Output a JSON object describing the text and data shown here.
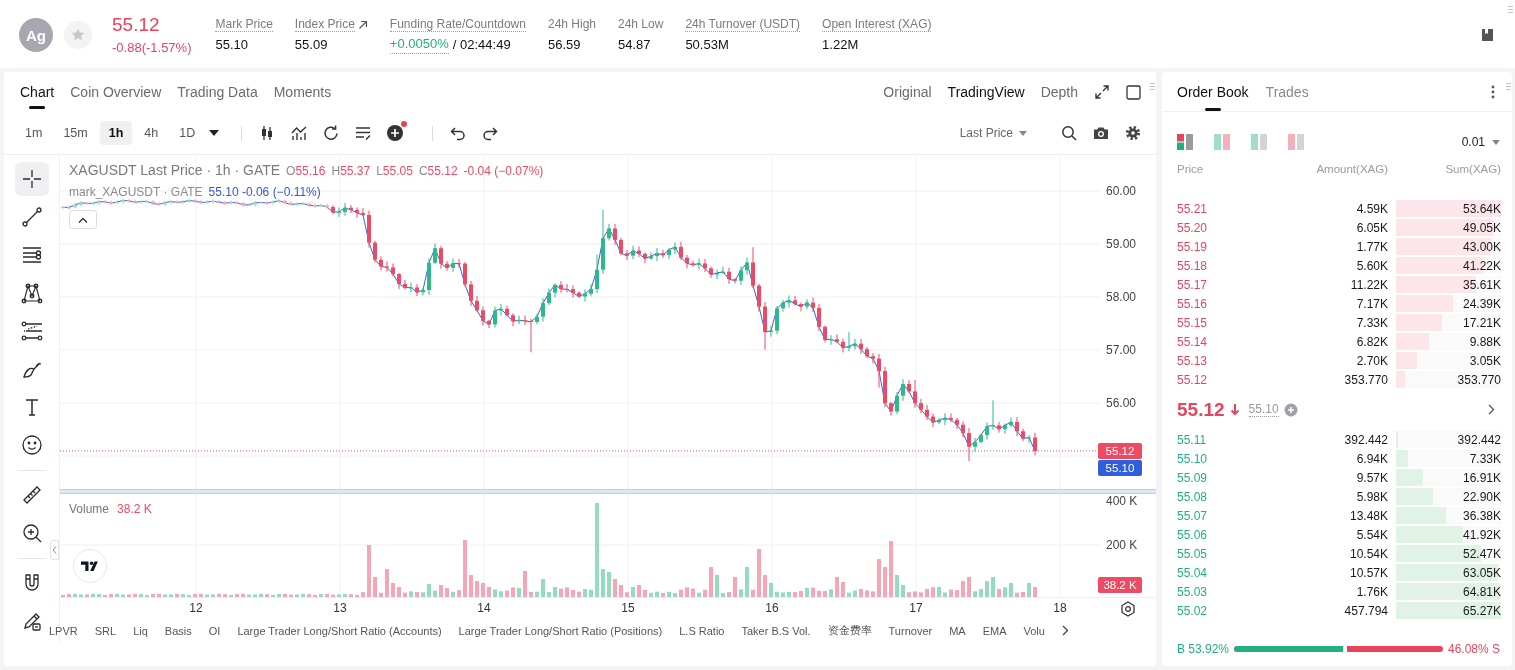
{
  "header": {
    "avatar": "Ag",
    "favorite": false,
    "last_price": "55.12",
    "change": "-0.88(-1.57%)",
    "stats": [
      {
        "label": "Mark Price",
        "underlined": true,
        "link": false,
        "value": "55.10"
      },
      {
        "label": "Index Price",
        "underlined": true,
        "link": true,
        "value": "55.09"
      },
      {
        "label": "Funding Rate/Countdown",
        "underlined": true,
        "link": false,
        "rate": "+0.0050%",
        "value": "/ 02:44:49"
      },
      {
        "label": "24h High",
        "underlined": false,
        "link": false,
        "value": "56.59"
      },
      {
        "label": "24h Low",
        "underlined": false,
        "link": false,
        "value": "54.87"
      },
      {
        "label": "24h Turnover (USDT)",
        "underlined": true,
        "link": false,
        "value": "50.53M"
      },
      {
        "label": "Open Interest (XAG)",
        "underlined": true,
        "link": false,
        "value": "1.22M"
      }
    ]
  },
  "chart_panel": {
    "tabs": [
      {
        "label": "Chart",
        "selected": true
      },
      {
        "label": "Coin Overview",
        "selected": false
      },
      {
        "label": "Trading Data",
        "selected": false
      },
      {
        "label": "Moments",
        "selected": false
      }
    ],
    "views": [
      {
        "label": "Original",
        "selected": false
      },
      {
        "label": "TradingView",
        "selected": true
      },
      {
        "label": "Depth",
        "selected": false
      }
    ],
    "intervals": [
      {
        "label": "1m",
        "selected": false
      },
      {
        "label": "15m",
        "selected": false
      },
      {
        "label": "1h",
        "selected": true
      },
      {
        "label": "4h",
        "selected": false
      },
      {
        "label": "1D",
        "selected": false
      }
    ],
    "add_indicator_dot": true,
    "price_source": "Last Price",
    "drawing_tools": [
      {
        "selected": true
      },
      {
        "selected": false
      },
      {
        "selected": false
      },
      {
        "selected": false
      },
      {
        "selected": false
      },
      {
        "selected": false
      },
      {
        "selected": false
      },
      {
        "selected": false
      },
      {
        "selected": false
      },
      {
        "selected": false
      },
      {
        "selected": false
      },
      {
        "selected": false
      }
    ],
    "legend": {
      "title": "XAGUSDT Last Price · 1h · GATE",
      "ohlc": [
        {
          "key": "O",
          "value": "55.16"
        },
        {
          "key": "H",
          "value": "55.37"
        },
        {
          "key": "L",
          "value": "55.05"
        },
        {
          "key": "C",
          "value": "55.12"
        }
      ],
      "change": "-0.04 (−0.07%)",
      "mark_title": "mark_XAGUSDT · GATE",
      "mark_values": "55.10 -0.06 (−0.11%)"
    },
    "price_axis": [
      "60.00",
      "59.00",
      "58.00",
      "57.00",
      "56.00"
    ],
    "price_tags": [
      {
        "kind": "last",
        "text": "55.12"
      },
      {
        "kind": "mark",
        "text": "55.10"
      }
    ],
    "volume_legend": {
      "label": "Volume",
      "value": "38.2 K"
    },
    "volume_axis": [
      "400 K",
      "200 K"
    ],
    "volume_tag": "38.2 K",
    "time_axis": [
      "12",
      "13",
      "14",
      "15",
      "16",
      "17",
      "18"
    ],
    "indicators": [
      "LPVR",
      "SRL",
      "Liq",
      "Basis",
      "OI",
      "Large Trader Long/Short Ratio (Accounts)",
      "Large Trader Long/Short Ratio (Positions)",
      "L.S Ratio",
      "Taker B.S Vol.",
      "资金费率",
      "Turnover",
      "MA",
      "EMA",
      "Volu"
    ]
  },
  "order_book": {
    "tabs": [
      {
        "label": "Order Book",
        "selected": true
      },
      {
        "label": "Trades",
        "selected": false
      }
    ],
    "layouts": [
      {
        "selected": true
      },
      {
        "selected": false
      },
      {
        "selected": false
      },
      {
        "selected": false
      }
    ],
    "precision": "0.01",
    "columns": [
      "Price",
      "Amount(XAG)",
      "Sum(XAG)"
    ],
    "asks": [
      {
        "price": "55.21",
        "amount": "4.59K",
        "sum": "53.64K",
        "level": 1
      },
      {
        "price": "55.20",
        "amount": "6.05K",
        "sum": "49.05K",
        "level": 0.93
      },
      {
        "price": "55.19",
        "amount": "1.77K",
        "sum": "43.00K",
        "level": 0.9
      },
      {
        "price": "55.18",
        "amount": "5.60K",
        "sum": "41.22K",
        "level": 0.83
      },
      {
        "price": "55.17",
        "amount": "11.22K",
        "sum": "35.61K",
        "level": 0.76
      },
      {
        "price": "55.16",
        "amount": "7.17K",
        "sum": "24.39K",
        "level": 0.54
      },
      {
        "price": "55.15",
        "amount": "7.33K",
        "sum": "17.21K",
        "level": 0.44
      },
      {
        "price": "55.14",
        "amount": "6.82K",
        "sum": "9.88K",
        "level": 0.31
      },
      {
        "price": "55.13",
        "amount": "2.70K",
        "sum": "3.05K",
        "level": 0.2
      },
      {
        "price": "55.12",
        "amount": "353.770",
        "sum": "353.770",
        "level": 0.09
      }
    ],
    "last_price": "55.12",
    "mark_price": "55.10",
    "bids": [
      {
        "price": "55.11",
        "amount": "392.442",
        "sum": "392.442",
        "level": 0.02
      },
      {
        "price": "55.10",
        "amount": "6.94K",
        "sum": "7.33K",
        "level": 0.11
      },
      {
        "price": "55.09",
        "amount": "9.57K",
        "sum": "16.91K",
        "level": 0.26
      },
      {
        "price": "55.08",
        "amount": "5.98K",
        "sum": "22.90K",
        "level": 0.35
      },
      {
        "price": "55.07",
        "amount": "13.48K",
        "sum": "36.38K",
        "level": 0.48
      },
      {
        "price": "55.06",
        "amount": "5.54K",
        "sum": "41.92K",
        "level": 0.64
      },
      {
        "price": "55.05",
        "amount": "10.54K",
        "sum": "52.47K",
        "level": 0.81
      },
      {
        "price": "55.04",
        "amount": "10.57K",
        "sum": "63.05K",
        "level": 0.97
      },
      {
        "price": "55.03",
        "amount": "1.76K",
        "sum": "64.81K",
        "level": 0.99
      },
      {
        "price": "55.02",
        "amount": "457.794",
        "sum": "65.27K",
        "level": 1
      }
    ],
    "ratio": {
      "buy": "B 53.92%",
      "sell": "46.08% S",
      "level": 0.5392
    }
  }
}
